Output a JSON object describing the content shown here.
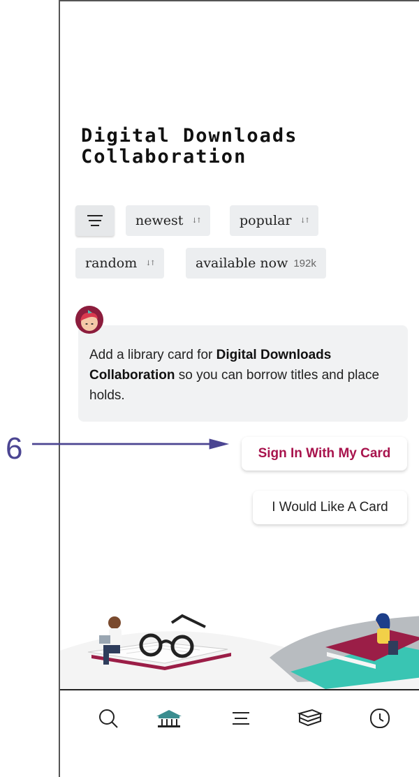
{
  "library": {
    "title_line1": "Digital Downloads",
    "title_line2": "Collaboration"
  },
  "filters": {
    "newest": "newest",
    "popular": "popular",
    "random": "random",
    "available": "available now",
    "available_count": "192k",
    "sort_glyph": "↓↑"
  },
  "card_prompt": {
    "text_before": "Add a library card for ",
    "library_name": "Digital Downloads Collaboration",
    "text_after": " so you can borrow titles and place holds."
  },
  "buttons": {
    "sign_in": "Sign In With My Card",
    "request_card": "I Would Like A Card"
  },
  "annotation": {
    "label": "6"
  },
  "nav": {
    "items": [
      "search-icon",
      "library-icon",
      "menu-icon",
      "shelf-icon",
      "history-icon"
    ]
  },
  "colors": {
    "accent": "#a8144d",
    "annotation": "#4b4592",
    "chip_bg": "#eceef0",
    "library_teal": "#3b8d8f"
  }
}
